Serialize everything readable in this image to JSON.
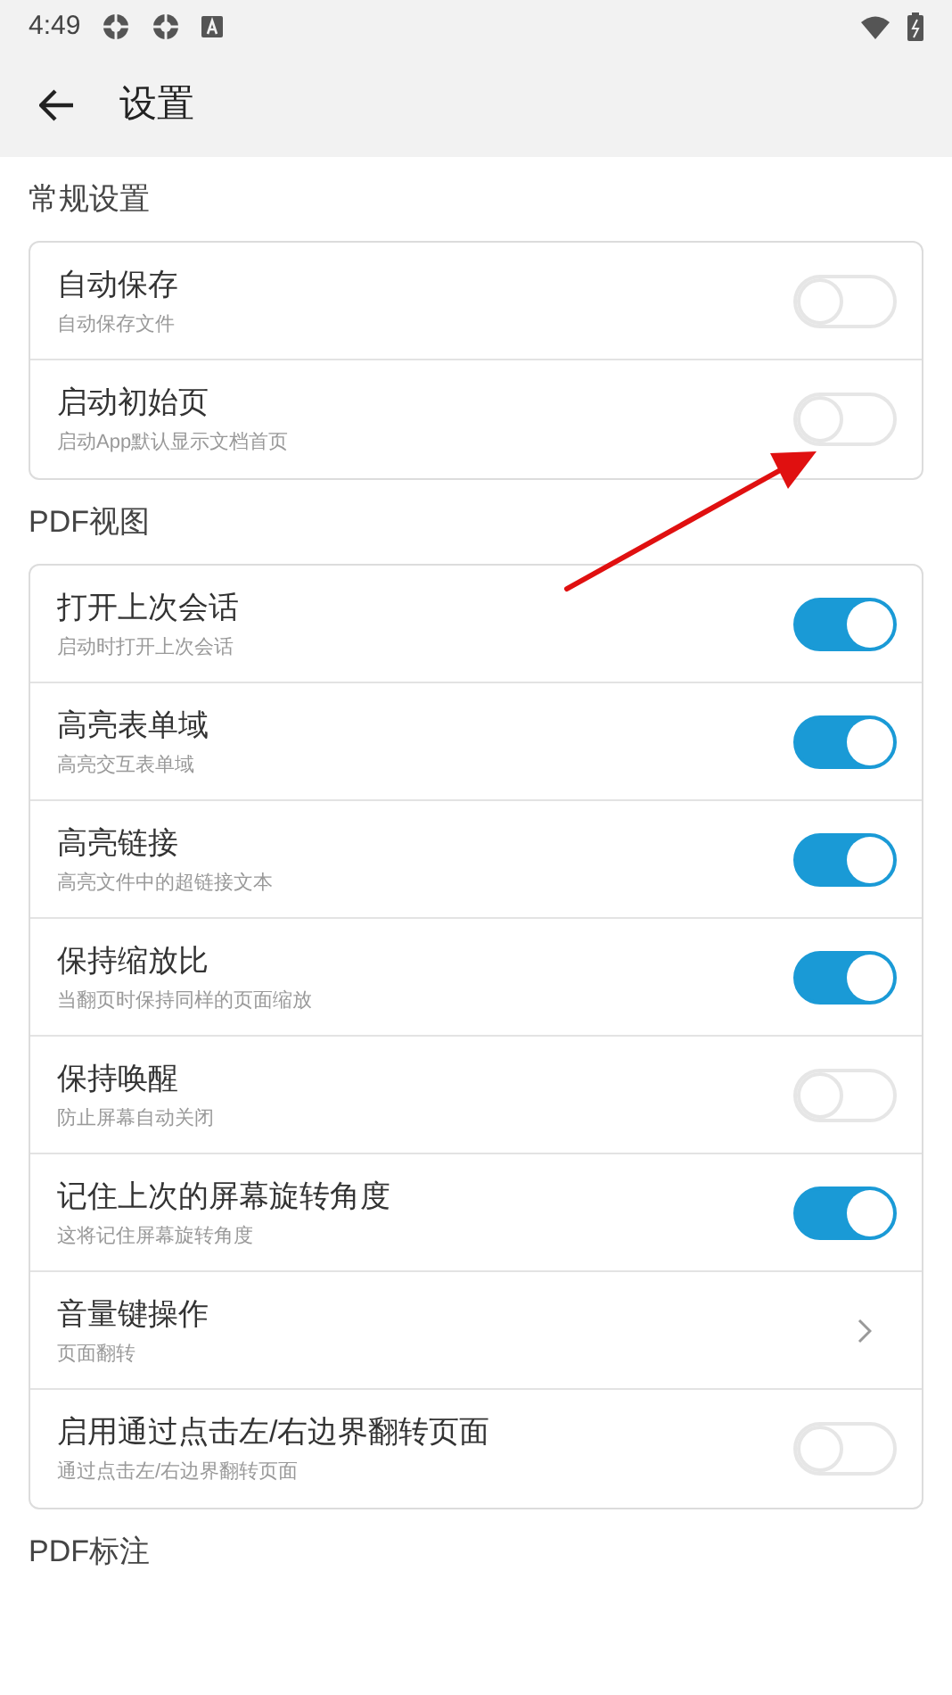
{
  "status_bar": {
    "time": "4:49"
  },
  "app_bar": {
    "title": "设置"
  },
  "sections": [
    {
      "title": "常规设置",
      "items": [
        {
          "kind": "switch",
          "title": "自动保存",
          "subtitle": "自动保存文件",
          "on": false
        },
        {
          "kind": "switch",
          "title": "启动初始页",
          "subtitle": "启动App默认显示文档首页",
          "on": false
        }
      ]
    },
    {
      "title": "PDF视图",
      "items": [
        {
          "kind": "switch",
          "title": "打开上次会话",
          "subtitle": "启动时打开上次会话",
          "on": true
        },
        {
          "kind": "switch",
          "title": "高亮表单域",
          "subtitle": "高亮交互表单域",
          "on": true
        },
        {
          "kind": "switch",
          "title": "高亮链接",
          "subtitle": "高亮文件中的超链接文本",
          "on": true
        },
        {
          "kind": "switch",
          "title": "保持缩放比",
          "subtitle": "当翻页时保持同样的页面缩放",
          "on": true
        },
        {
          "kind": "switch",
          "title": "保持唤醒",
          "subtitle": "防止屏幕自动关闭",
          "on": false
        },
        {
          "kind": "switch",
          "title": "记住上次的屏幕旋转角度",
          "subtitle": "这将记住屏幕旋转角度",
          "on": true
        },
        {
          "kind": "link",
          "title": "音量键操作",
          "subtitle": "页面翻转"
        },
        {
          "kind": "switch",
          "title": "启用通过点击左/右边界翻转页面",
          "subtitle": "通过点击左/右边界翻转页面",
          "on": false
        }
      ]
    },
    {
      "title": "PDF标注"
    }
  ]
}
